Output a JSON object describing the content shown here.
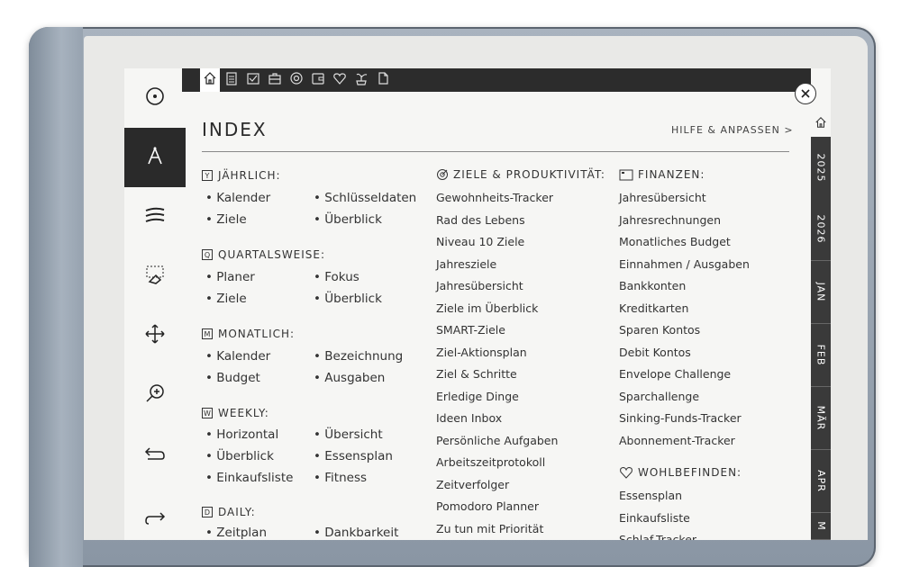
{
  "index": {
    "title": "INDEX",
    "help": "HILFE & ANPASSEN >"
  },
  "sections": {
    "yearly": {
      "label": "JÄHRLICH:",
      "icon_letter": "Y",
      "items": [
        "Kalender",
        "Schlüsseldaten",
        "Ziele",
        "Überblick"
      ]
    },
    "quarterly": {
      "label": "QUARTALSWEISE:",
      "icon_letter": "Q",
      "items": [
        "Planer",
        "Fokus",
        "Ziele",
        "Überblick"
      ]
    },
    "monthly": {
      "label": "MONATLICH:",
      "icon_letter": "M",
      "items": [
        "Kalender",
        "Bezeichnung",
        "Budget",
        "Ausgaben"
      ]
    },
    "weekly": {
      "label": "WEEKLY:",
      "icon_letter": "W",
      "items": [
        "Horizontal",
        "Übersicht",
        "Überblick",
        "Essensplan",
        "Einkaufsliste",
        "Fitness"
      ]
    },
    "daily": {
      "label": "DAILY:",
      "icon_letter": "D",
      "items": [
        "Zeitplan",
        "Dankbarkeit"
      ]
    }
  },
  "goals": {
    "label": "ZIELE & PRODUKTIVITÄT:",
    "items": [
      "Gewohnheits-Tracker",
      "Rad des Lebens",
      "Niveau 10 Ziele",
      "Jahresziele",
      "Jahresübersicht",
      "Ziele im Überblick",
      "SMART-Ziele",
      "Ziel-Aktionsplan",
      "Ziel & Schritte",
      "Erledige Dinge",
      "Ideen Inbox",
      "Persönliche Aufgaben",
      "Arbeitszeitprotokoll",
      "Zeitverfolger",
      "Pomodoro Planner",
      "Zu tun mit Priorität"
    ]
  },
  "finance": {
    "label": "FINANZEN:",
    "items": [
      "Jahresübersicht",
      "Jahresrechnungen",
      "Monatliches Budget",
      "Einnahmen / Ausgaben",
      "Bankkonten",
      "Kreditkarten",
      "Sparen Kontos",
      "Debit Kontos",
      "Envelope Challenge",
      "Sparchallenge",
      "Sinking-Funds-Tracker",
      "Abonnement-Tracker"
    ]
  },
  "wellbeing": {
    "label": "WOHLBEFINDEN:",
    "items": [
      "Essensplan",
      "Einkaufsliste",
      "Schlaf-Tracker"
    ]
  },
  "tabs": [
    "2025",
    "2026",
    "JAN",
    "FEB",
    "MÄR",
    "APR",
    "M"
  ],
  "icons": {
    "left_toolbar": [
      "menu-circle-icon",
      "pen-tool-icon",
      "lines-icon",
      "eraser-icon",
      "move-icon",
      "zoom-in-icon",
      "undo-icon",
      "redo-icon"
    ],
    "top_bar": [
      "home-icon",
      "clipboard-icon",
      "checkbox-icon",
      "briefcase-icon",
      "target-icon",
      "wallet-icon",
      "heart-icon",
      "plant-icon",
      "page-icon"
    ]
  },
  "colors": {
    "ink": "#333333",
    "toolbar_dark": "#2c2c2c",
    "paper": "#f6f6f4"
  }
}
